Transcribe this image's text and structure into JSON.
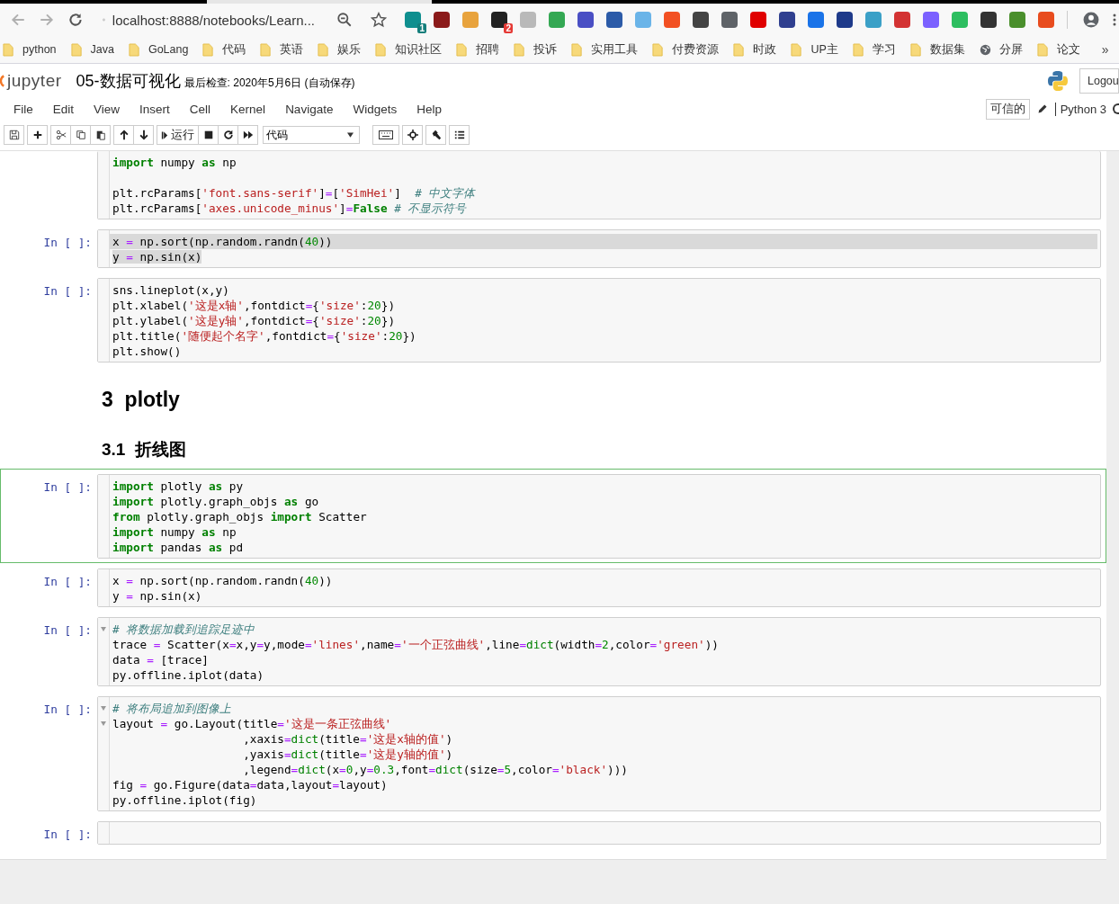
{
  "browser": {
    "url": "localhost:8888/notebooks/Learn...",
    "extensions": [
      {
        "color": "#0f8f8f",
        "badge": "1"
      },
      {
        "color": "#8b1a1a"
      },
      {
        "color": "#e8a33d"
      },
      {
        "color": "#222222",
        "badge": "2"
      },
      {
        "color": "#b9b9b9"
      },
      {
        "color": "#34a853"
      },
      {
        "color": "#4a4fc4"
      },
      {
        "color": "#2c5ba8"
      },
      {
        "color": "#6ab4e8"
      },
      {
        "color": "#f25022"
      },
      {
        "color": "#444444"
      },
      {
        "color": "#5f6368"
      },
      {
        "color": "#e00000"
      },
      {
        "color": "#2f3f8f"
      },
      {
        "color": "#1a73e8"
      },
      {
        "color": "#1e3a8a"
      },
      {
        "color": "#3ba0c7"
      },
      {
        "color": "#d33333"
      },
      {
        "color": "#7b61ff"
      },
      {
        "color": "#2dbe60"
      },
      {
        "color": "#333333"
      },
      {
        "color": "#4a8f2c"
      },
      {
        "color": "#e84c1e"
      }
    ],
    "bookmarks": [
      {
        "kind": "folder",
        "label": "python"
      },
      {
        "kind": "folder",
        "label": "Java"
      },
      {
        "kind": "folder",
        "label": "GoLang"
      },
      {
        "kind": "folder",
        "label": "代码"
      },
      {
        "kind": "folder",
        "label": "英语"
      },
      {
        "kind": "folder",
        "label": "娱乐"
      },
      {
        "kind": "folder",
        "label": "知识社区"
      },
      {
        "kind": "folder",
        "label": "招聘"
      },
      {
        "kind": "folder",
        "label": "投诉"
      },
      {
        "kind": "folder",
        "label": "实用工具"
      },
      {
        "kind": "folder",
        "label": "付费资源"
      },
      {
        "kind": "folder",
        "label": "时政"
      },
      {
        "kind": "folder",
        "label": "UP主"
      },
      {
        "kind": "folder",
        "label": "学习"
      },
      {
        "kind": "folder",
        "label": "数据集"
      },
      {
        "kind": "globe",
        "label": "分屏"
      },
      {
        "kind": "folder",
        "label": "论文"
      }
    ],
    "bookmarks_overflow": "»"
  },
  "header": {
    "logo": "jupyter",
    "title": "05-数据可视化",
    "checkpoint": "最后检查: 2020年5月6日  (自动保存)",
    "logout": "Logou"
  },
  "menu": [
    "File",
    "Edit",
    "View",
    "Insert",
    "Cell",
    "Kernel",
    "Navigate",
    "Widgets",
    "Help"
  ],
  "trusted": "可信的",
  "kernel": "Python 3",
  "toolbar": {
    "run_label": "运行",
    "cell_type": "代码"
  },
  "cells": [
    {
      "kind": "code",
      "selected": false,
      "text_selected": false,
      "lines": [
        {
          "tokens": [
            {
              "kind": "keyword",
              "text": "import"
            },
            " numpy ",
            {
              "kind": "keyword",
              "text": "as"
            },
            " np"
          ]
        },
        {
          "space_above": true,
          "tokens": [
            "plt.rcParams[",
            {
              "kind": "string",
              "text": "'font.sans-serif'"
            },
            "]",
            {
              "kind": "operator",
              "text": "="
            },
            "[",
            {
              "kind": "string",
              "text": "'SimHei'"
            },
            "]  ",
            {
              "kind": "comment",
              "text": "# 中文字体"
            }
          ]
        },
        {
          "tokens": [
            "plt.rcParams[",
            {
              "kind": "string",
              "text": "'axes.unicode_minus'"
            },
            "]",
            {
              "kind": "operator",
              "text": "="
            },
            {
              "kind": "keyword",
              "text": "False"
            },
            {
              "kind": "comment",
              "text": " # 不显示符号"
            }
          ]
        }
      ]
    },
    {
      "kind": "code",
      "prompt": "In [ ]:",
      "selected": false,
      "text_selected": true,
      "lines": [
        {
          "tokens": [
            "x ",
            {
              "kind": "operator",
              "text": "="
            },
            " np.sort(np.random.randn(",
            {
              "kind": "number",
              "text": "40"
            },
            "))"
          ]
        },
        {
          "tokens": [
            "y ",
            {
              "kind": "operator",
              "text": "="
            },
            " np.sin(x)"
          ]
        }
      ]
    },
    {
      "kind": "code",
      "prompt": "In [ ]:",
      "selected": false,
      "text_selected": false,
      "lines": [
        {
          "tokens": [
            "sns.lineplot(x,y)"
          ]
        },
        {
          "tokens": [
            "plt.xlabel(",
            {
              "kind": "string",
              "text": "'这是x轴'"
            },
            ",fontdict",
            {
              "kind": "operator",
              "text": "="
            },
            "{",
            {
              "kind": "string",
              "text": "'size'"
            },
            ":",
            {
              "kind": "number",
              "text": "20"
            },
            "})"
          ]
        },
        {
          "tokens": [
            "plt.ylabel(",
            {
              "kind": "string",
              "text": "'这是y轴'"
            },
            ",fontdict",
            {
              "kind": "operator",
              "text": "="
            },
            "{",
            {
              "kind": "string",
              "text": "'size'"
            },
            ":",
            {
              "kind": "number",
              "text": "20"
            },
            "})"
          ]
        },
        {
          "tokens": [
            "plt.title(",
            {
              "kind": "string",
              "text": "'随便起个名字'"
            },
            ",fontdict",
            {
              "kind": "operator",
              "text": "="
            },
            "{",
            {
              "kind": "string",
              "text": "'size'"
            },
            ":",
            {
              "kind": "number",
              "text": "20"
            },
            "})"
          ]
        },
        {
          "tokens": [
            "plt.show()"
          ]
        }
      ]
    },
    {
      "kind": "h2",
      "selected": false,
      "number": "3",
      "title": "plotly"
    },
    {
      "kind": "h3",
      "selected": false,
      "number": "3.1",
      "title": "折线图"
    },
    {
      "kind": "code",
      "prompt": "In [ ]:",
      "selected": true,
      "text_selected": false,
      "lines": [
        {
          "tokens": [
            {
              "kind": "keyword",
              "text": "import"
            },
            " plotly ",
            {
              "kind": "keyword",
              "text": "as"
            },
            " py"
          ]
        },
        {
          "tokens": [
            {
              "kind": "keyword",
              "text": "import"
            },
            " plotly.graph_objs ",
            {
              "kind": "keyword",
              "text": "as"
            },
            " go"
          ]
        },
        {
          "tokens": [
            {
              "kind": "keyword",
              "text": "from"
            },
            " plotly.graph_objs ",
            {
              "kind": "keyword",
              "text": "import"
            },
            " Scatter"
          ]
        },
        {
          "tokens": [
            {
              "kind": "keyword",
              "text": "import"
            },
            " numpy ",
            {
              "kind": "keyword",
              "text": "as"
            },
            " np"
          ]
        },
        {
          "tokens": [
            {
              "kind": "keyword",
              "text": "import"
            },
            " pandas ",
            {
              "kind": "keyword",
              "text": "as"
            },
            " pd"
          ]
        }
      ]
    },
    {
      "kind": "code",
      "prompt": "In [ ]:",
      "selected": false,
      "text_selected": false,
      "lines": [
        {
          "tokens": [
            "x ",
            {
              "kind": "operator",
              "text": "="
            },
            " np.sort(np.random.randn(",
            {
              "kind": "number",
              "text": "40"
            },
            "))"
          ]
        },
        {
          "tokens": [
            "y ",
            {
              "kind": "operator",
              "text": "="
            },
            " np.sin(x)"
          ]
        }
      ]
    },
    {
      "kind": "code",
      "prompt": "In [ ]:",
      "selected": false,
      "text_selected": false,
      "lines": [
        {
          "fold": true,
          "tokens": [
            {
              "kind": "comment",
              "text": "# 将数据加载到追踪足迹中"
            }
          ]
        },
        {
          "tokens": [
            "trace ",
            {
              "kind": "operator",
              "text": "="
            },
            " Scatter(x",
            {
              "kind": "operator",
              "text": "="
            },
            "x,y",
            {
              "kind": "operator",
              "text": "="
            },
            "y,mode",
            {
              "kind": "operator",
              "text": "="
            },
            {
              "kind": "string",
              "text": "'lines'"
            },
            ",name",
            {
              "kind": "operator",
              "text": "="
            },
            {
              "kind": "string",
              "text": "'一个正弦曲线'"
            },
            ",line",
            {
              "kind": "operator",
              "text": "="
            },
            {
              "kind": "builtin",
              "text": "dict"
            },
            "(width",
            {
              "kind": "operator",
              "text": "="
            },
            {
              "kind": "number",
              "text": "2"
            },
            ",color",
            {
              "kind": "operator",
              "text": "="
            },
            {
              "kind": "string",
              "text": "'green'"
            },
            "))"
          ]
        },
        {
          "tokens": [
            "data ",
            {
              "kind": "operator",
              "text": "="
            },
            " [trace]"
          ]
        },
        {
          "tokens": [
            "py.offline.iplot(data)"
          ]
        }
      ]
    },
    {
      "kind": "code",
      "prompt": "In [ ]:",
      "selected": false,
      "text_selected": false,
      "lines": [
        {
          "fold": true,
          "tokens": [
            {
              "kind": "comment",
              "text": "# 将布局追加到图像上"
            }
          ]
        },
        {
          "fold": true,
          "tokens": [
            "layout ",
            {
              "kind": "operator",
              "text": "="
            },
            " go.Layout(title",
            {
              "kind": "operator",
              "text": "="
            },
            {
              "kind": "string",
              "text": "'这是一条正弦曲线'"
            }
          ]
        },
        {
          "tokens": [
            "                   ,xaxis",
            {
              "kind": "operator",
              "text": "="
            },
            {
              "kind": "builtin",
              "text": "dict"
            },
            "(title",
            {
              "kind": "operator",
              "text": "="
            },
            {
              "kind": "string",
              "text": "'这是x轴的值'"
            },
            ")"
          ]
        },
        {
          "tokens": [
            "                   ,yaxis",
            {
              "kind": "operator",
              "text": "="
            },
            {
              "kind": "builtin",
              "text": "dict"
            },
            "(title",
            {
              "kind": "operator",
              "text": "="
            },
            {
              "kind": "string",
              "text": "'这是y轴的值'"
            },
            ")"
          ]
        },
        {
          "tokens": [
            "                   ,legend",
            {
              "kind": "operator",
              "text": "="
            },
            {
              "kind": "builtin",
              "text": "dict"
            },
            "(x",
            {
              "kind": "operator",
              "text": "="
            },
            {
              "kind": "number",
              "text": "0"
            },
            ",y",
            {
              "kind": "operator",
              "text": "="
            },
            {
              "kind": "number",
              "text": "0.3"
            },
            ",font",
            {
              "kind": "operator",
              "text": "="
            },
            {
              "kind": "builtin",
              "text": "dict"
            },
            "(size",
            {
              "kind": "operator",
              "text": "="
            },
            {
              "kind": "number",
              "text": "5"
            },
            ",color",
            {
              "kind": "operator",
              "text": "="
            },
            {
              "kind": "string",
              "text": "'black'"
            },
            ")))"
          ]
        },
        {
          "tokens": [
            "fig ",
            {
              "kind": "operator",
              "text": "="
            },
            " go.Figure(data",
            {
              "kind": "operator",
              "text": "="
            },
            "data,layout",
            {
              "kind": "operator",
              "text": "="
            },
            "layout)"
          ]
        },
        {
          "tokens": [
            "py.offline.iplot(fig)"
          ]
        }
      ]
    },
    {
      "kind": "code",
      "prompt": "In [ ]:",
      "selected": false
    }
  ]
}
